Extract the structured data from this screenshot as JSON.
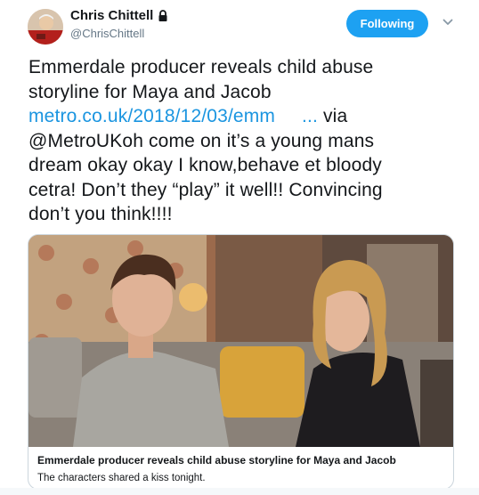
{
  "user": {
    "display_name": "Chris Chittell",
    "handle": "@ChrisChittell",
    "avatar_icon": "profile-photo",
    "protected_icon": "lock-icon"
  },
  "actions": {
    "follow_label": "Following",
    "menu_icon": "chevron-down-icon"
  },
  "tweet": {
    "lines": [
      "Emmerdale producer reveals child abuse",
      "storyline for Maya and Jacob",
      "@MetroUKoh come on it’s a young mans",
      "dream okay okay I know,behave et bloody",
      "cetra! Don’t they “play” it well!! Convincing",
      "don’t you think!!!!"
    ],
    "link": "metro.co.uk/2018/12/03/emm",
    "link_ellipsis": "...",
    "via": " via"
  },
  "card": {
    "title": "Emmerdale producer reveals child abuse storyline for Maya and Jacob",
    "description": "The characters shared a kiss tonight."
  },
  "colors": {
    "accent": "#1da1f2",
    "link": "#1b95e0",
    "text": "#14171a",
    "muted": "#657786"
  }
}
